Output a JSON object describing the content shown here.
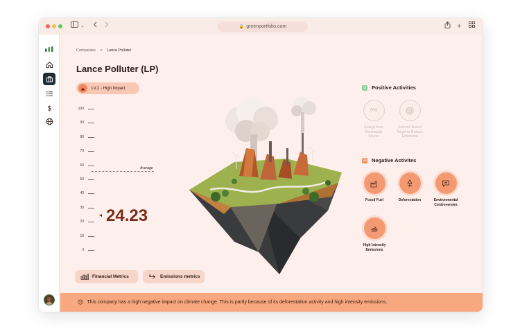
{
  "browser": {
    "url": "greenportfolio.com",
    "colors": {
      "close": "#f4625b",
      "minimize": "#f6be4f",
      "maximize": "#5dc85a"
    }
  },
  "sidebar": {
    "items": [
      {
        "icon": "home-icon"
      },
      {
        "icon": "briefcase-icon",
        "active": true
      },
      {
        "icon": "list-icon"
      },
      {
        "icon": "dollar-icon"
      },
      {
        "icon": "globe-icon"
      }
    ]
  },
  "breadcrumb": {
    "parent": "Companies",
    "separator": ">",
    "current": "Lance Polluter"
  },
  "company": {
    "name": "Lance Polluter (LP)",
    "impact_label": "LV.2 - High Impact"
  },
  "gauge": {
    "ticks": [
      "100",
      "90",
      "80",
      "70",
      "60",
      "50",
      "40",
      "30",
      "20",
      "10",
      "0"
    ],
    "average_label": "Average",
    "average_value": 56,
    "score": "24.23"
  },
  "buttons": {
    "financial": "Financial Metrics",
    "emissions": "Emissions metrics"
  },
  "positive": {
    "title": "Positive Activities",
    "items": [
      {
        "value": "0%",
        "label_lines": [
          "Energy from",
          "Renewable",
          "Source"
        ]
      },
      {
        "icon": "target-icon",
        "label_lines": [
          "Science Based",
          "Target to Reduce",
          "Emissions"
        ]
      }
    ]
  },
  "negative": {
    "title": "Negative Activites",
    "items": [
      {
        "icon": "factory-icon",
        "label_lines": [
          "Fossil Fuel"
        ]
      },
      {
        "icon": "tree-cut-icon",
        "label_lines": [
          "Deforestation"
        ]
      },
      {
        "icon": "chat-warning-icon",
        "label_lines": [
          "Environmental",
          "Controversies"
        ]
      },
      {
        "icon": "smoke-icon",
        "label_lines": [
          "High Intensity",
          "Emissions"
        ]
      }
    ]
  },
  "banner": {
    "text": "This company has a high negative impact on climate change. This is partly because of its deforestation activity and high intensity emissions."
  }
}
